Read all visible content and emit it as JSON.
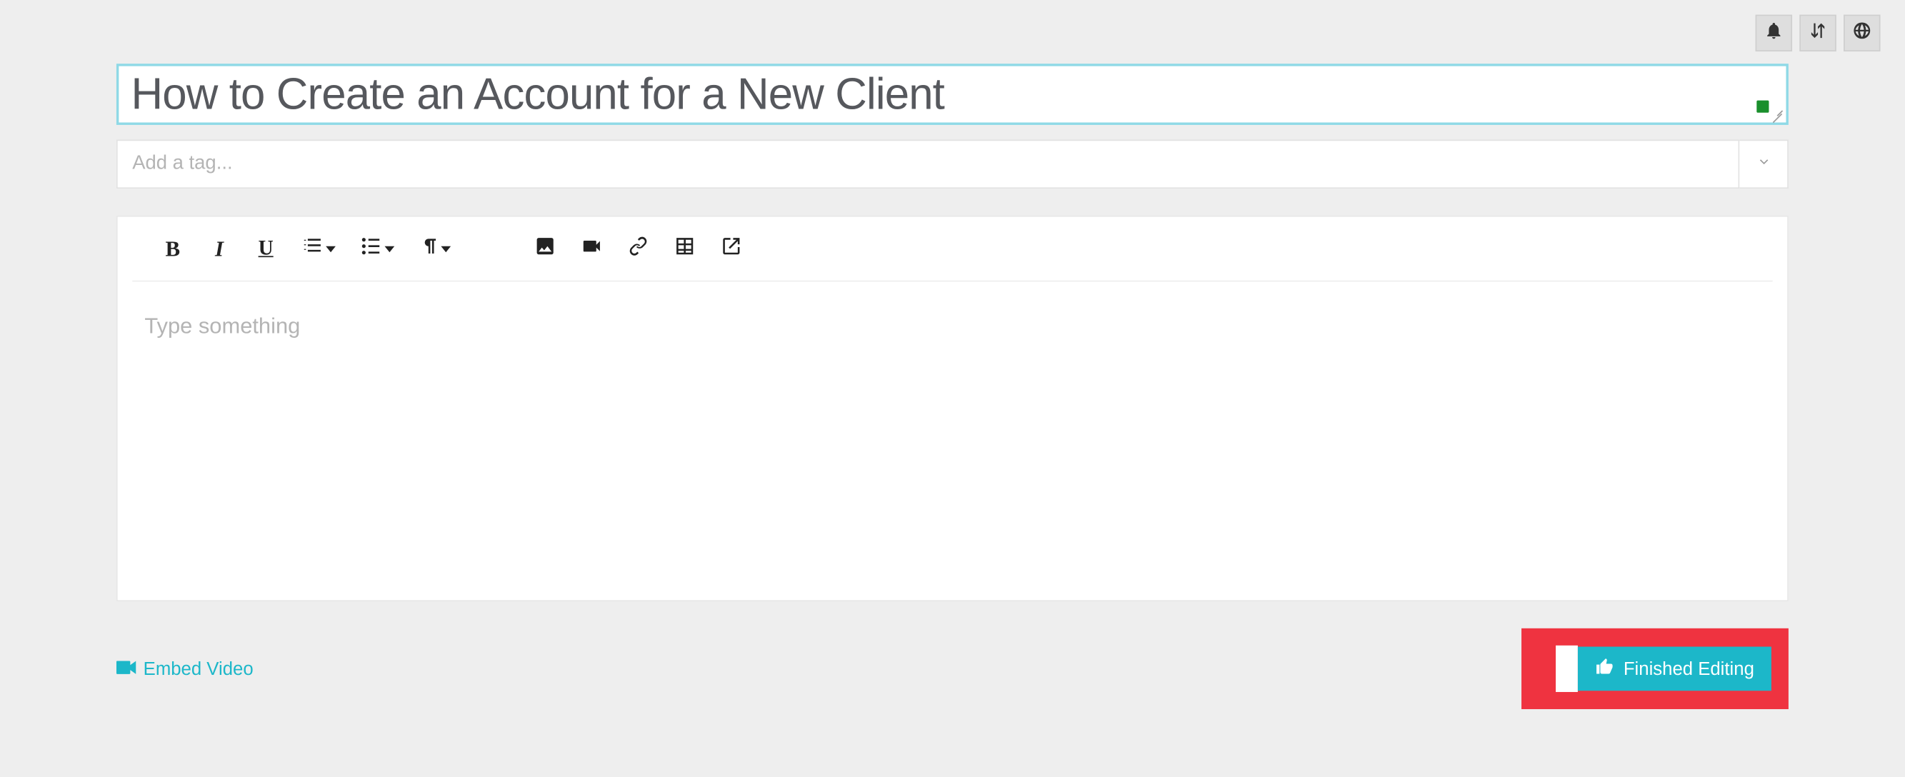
{
  "topbar": {
    "icons": [
      "bell-icon",
      "sort-icon",
      "globe-icon"
    ]
  },
  "title": {
    "value": "How to Create an Account for a New Client",
    "placeholder": ""
  },
  "tags": {
    "placeholder": "Add a tag..."
  },
  "editor": {
    "placeholder": "Type something",
    "toolbar": {
      "bold": "B",
      "italic": "I",
      "underline": "U"
    }
  },
  "footer": {
    "embed_label": "Embed Video",
    "finished_label": "Finished Editing"
  },
  "colors": {
    "accent": "#1cb7c9",
    "highlight": "#ef3340",
    "focus_border": "#8fd9e6",
    "spell_indicator": "#1a8f2c"
  }
}
